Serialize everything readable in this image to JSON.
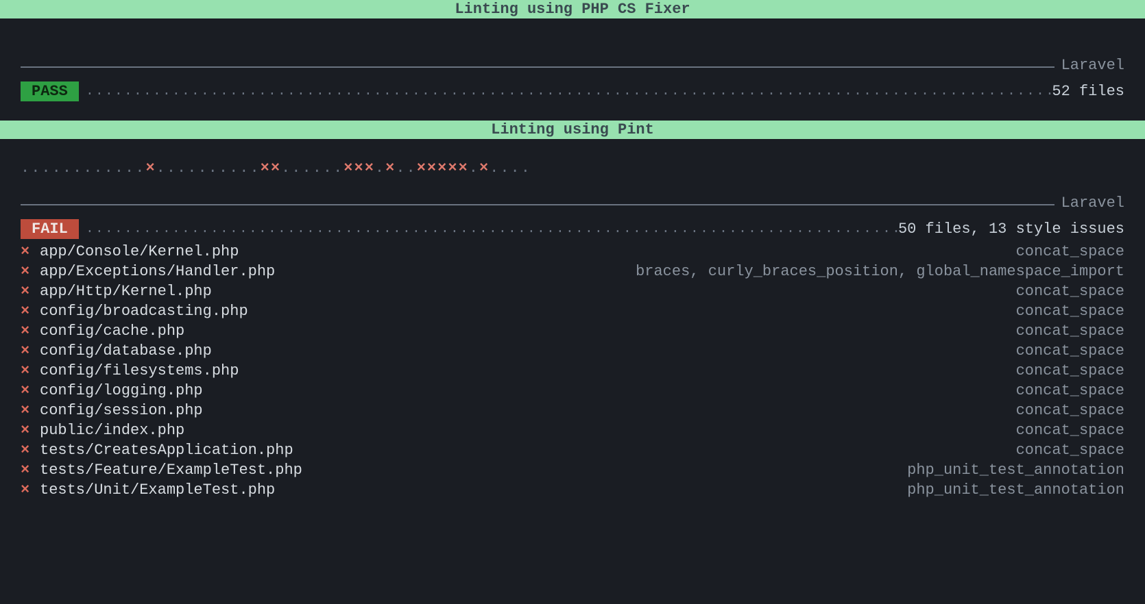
{
  "section1": {
    "header": "Linting using PHP CS Fixer",
    "preset_label": "Laravel",
    "status": "PASS",
    "summary": "52 files"
  },
  "section2": {
    "header": "Linting using Pint",
    "progress": "............x..........xx......xxx.x..xxxxx.x....",
    "preset_label": "Laravel",
    "status": "FAIL",
    "summary": "50 files, 13 style issues",
    "issues": [
      {
        "file": "app/Console/Kernel.php",
        "rules": "concat_space"
      },
      {
        "file": "app/Exceptions/Handler.php",
        "rules": "braces, curly_braces_position, global_namespace_import"
      },
      {
        "file": "app/Http/Kernel.php",
        "rules": "concat_space"
      },
      {
        "file": "config/broadcasting.php",
        "rules": "concat_space"
      },
      {
        "file": "config/cache.php",
        "rules": "concat_space"
      },
      {
        "file": "config/database.php",
        "rules": "concat_space"
      },
      {
        "file": "config/filesystems.php",
        "rules": "concat_space"
      },
      {
        "file": "config/logging.php",
        "rules": "concat_space"
      },
      {
        "file": "config/session.php",
        "rules": "concat_space"
      },
      {
        "file": "public/index.php",
        "rules": "concat_space"
      },
      {
        "file": "tests/CreatesApplication.php",
        "rules": "concat_space"
      },
      {
        "file": "tests/Feature/ExampleTest.php",
        "rules": "php_unit_test_annotation"
      },
      {
        "file": "tests/Unit/ExampleTest.php",
        "rules": "php_unit_test_annotation"
      }
    ]
  }
}
